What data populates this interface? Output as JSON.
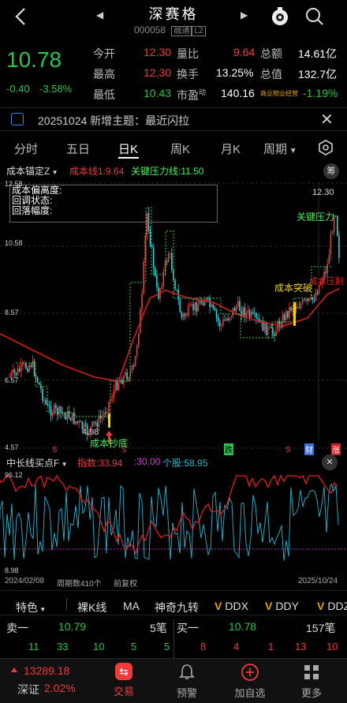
{
  "header": {
    "title": "深赛格",
    "code": "000058",
    "tags": "融通",
    "tag2": "L2"
  },
  "quote": {
    "price": "10.78",
    "change": "-0.40",
    "pct": "-3.58%",
    "items": [
      {
        "label": "今开",
        "value": "12.30"
      },
      {
        "label": "量比",
        "value": "9.64"
      },
      {
        "label": "总额",
        "value": "14.61亿"
      },
      {
        "label": "最高",
        "value": "12.30"
      },
      {
        "label": "换手",
        "value": "13.25%"
      },
      {
        "label": "总值",
        "value": "132.7亿"
      },
      {
        "label": "最低",
        "value": "10.43"
      },
      {
        "label": "市盈",
        "sup": "动",
        "value": "140.16"
      },
      {
        "label": "商业物业经营",
        "value": "-1.19%"
      }
    ]
  },
  "news": {
    "text": "20251024 新增主题：最近闪拉"
  },
  "tabs": [
    "分时",
    "五日",
    "日K",
    "周K",
    "月K",
    "周期"
  ],
  "chart": {
    "indicator": "成本锚定Z",
    "line_label": "成本线1:",
    "line_value": "9.64",
    "pressure_label": "关键压力线:",
    "pressure_value": "11.50",
    "chip_btn": "筹",
    "box_lines": [
      "成本偏离度:",
      "回调状态:",
      "回落幅度:"
    ],
    "y_ticks": [
      "12.58",
      "10.58",
      "8.57",
      "6.57",
      "4.57"
    ],
    "max_label": "12.30",
    "min_label": "4.98",
    "ann_bottom": "成本抄底",
    "ann_breakout": "成本突破",
    "ann_pressure": "关键压力",
    "ann_red": "成本压制",
    "markers": [
      "S",
      "S",
      "跌",
      "S",
      "财",
      "涨"
    ]
  },
  "sub": {
    "name": "中长线买点F",
    "idx_label": "指数:",
    "idx_value": "33.94",
    "v2": ":30.00",
    "stock_label": "个股:",
    "stock_value": "58.95",
    "y_top": "96.12",
    "y_bot": "8.98",
    "start": "2024/02/08",
    "period": "周期数410个",
    "adj": "前复权",
    "end": "2025/10/24"
  },
  "features": [
    "特色",
    "裸K线",
    "MA",
    "神奇九转",
    "DDX",
    "DDY",
    "DDZ"
  ],
  "orderbook": {
    "sell_label": "卖一",
    "sell_price": "10.79",
    "sell_vol": "5笔",
    "buy_label": "买一",
    "buy_price": "10.78",
    "buy_vol": "157笔",
    "sell_row": [
      "11",
      "33",
      "10",
      "5",
      "5"
    ],
    "buy_row": [
      "8",
      "4",
      "1",
      "13",
      "10"
    ]
  },
  "bottom": {
    "index_value": "13289.18",
    "index_name": "深证",
    "index_pct": "2.02%",
    "nav": [
      "交易",
      "预警",
      "加自选",
      "更多"
    ]
  }
}
